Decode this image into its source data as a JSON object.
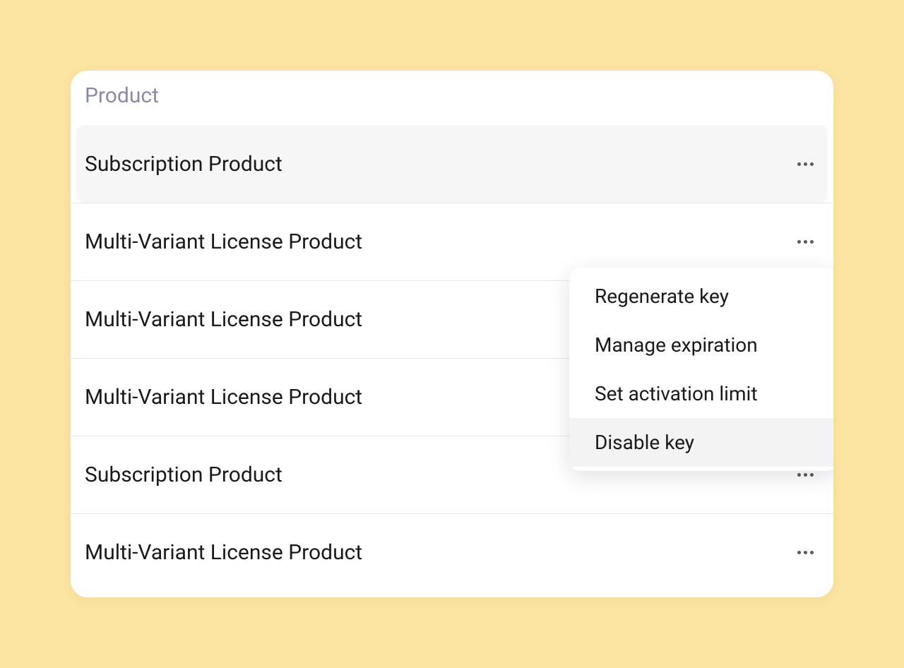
{
  "header": {
    "title": "Product"
  },
  "rows": [
    {
      "name": "Subscription Product",
      "highlighted": true
    },
    {
      "name": "Multi-Variant License Product",
      "highlighted": false
    },
    {
      "name": "Multi-Variant License Product",
      "highlighted": false
    },
    {
      "name": "Multi-Variant License Product",
      "highlighted": false
    },
    {
      "name": "Subscription Product",
      "highlighted": false
    },
    {
      "name": "Multi-Variant License Product",
      "highlighted": false
    }
  ],
  "dropdown": {
    "items": [
      {
        "label": "Regenerate key",
        "hovered": false
      },
      {
        "label": "Manage expiration",
        "hovered": false
      },
      {
        "label": "Set activation limit",
        "hovered": false
      },
      {
        "label": "Disable key",
        "hovered": true
      }
    ]
  }
}
